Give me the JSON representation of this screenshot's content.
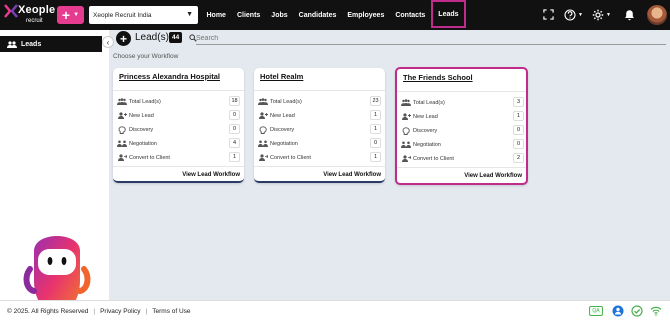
{
  "brand": {
    "name": "Xeople",
    "sub": "recruit"
  },
  "topbar": {
    "add_label": "+",
    "company": "Xeople Recruit India",
    "nav": [
      "Home",
      "Clients",
      "Jobs",
      "Candidates",
      "Employees",
      "Contacts",
      "Leads"
    ],
    "active_nav": "Leads",
    "icons": [
      "fullscreen-icon",
      "help-icon",
      "settings-icon",
      "bell-icon",
      "avatar"
    ]
  },
  "sidebar": {
    "items": [
      {
        "label": "Leads",
        "icon": "people-icon"
      }
    ]
  },
  "main": {
    "title": "Lead(s)",
    "count": "44",
    "search_placeholder": "Search",
    "workflow_label": "Choose your Workflow",
    "cards": [
      {
        "title": "Princess Alexandra Hospital",
        "rows": [
          {
            "label": "Total Lead(s)",
            "value": "18",
            "icon": "group-icon"
          },
          {
            "label": "New Lead",
            "value": "0",
            "icon": "add-person-icon"
          },
          {
            "label": "Discovery",
            "value": "0",
            "icon": "brain-icon"
          },
          {
            "label": "Negotiation",
            "value": "4",
            "icon": "meeting-icon"
          },
          {
            "label": "Convert to Client",
            "value": "1",
            "icon": "convert-person-icon"
          }
        ],
        "link": "View Lead Workflow",
        "highlighted": false
      },
      {
        "title": "Hotel Realm",
        "rows": [
          {
            "label": "Total Lead(s)",
            "value": "23",
            "icon": "group-icon"
          },
          {
            "label": "New Lead",
            "value": "1",
            "icon": "add-person-icon"
          },
          {
            "label": "Discovery",
            "value": "1",
            "icon": "brain-icon"
          },
          {
            "label": "Negotiation",
            "value": "0",
            "icon": "meeting-icon"
          },
          {
            "label": "Convert to Client",
            "value": "1",
            "icon": "convert-person-icon"
          }
        ],
        "link": "View Lead Workflow",
        "highlighted": false
      },
      {
        "title": "The Friends School",
        "rows": [
          {
            "label": "Total Lead(s)",
            "value": "3",
            "icon": "group-icon"
          },
          {
            "label": "New Lead",
            "value": "1",
            "icon": "add-person-icon"
          },
          {
            "label": "Discovery",
            "value": "0",
            "icon": "brain-icon"
          },
          {
            "label": "Negotiation",
            "value": "0",
            "icon": "meeting-icon"
          },
          {
            "label": "Convert to Client",
            "value": "2",
            "icon": "convert-person-icon"
          }
        ],
        "link": "View Lead Workflow",
        "highlighted": true
      }
    ]
  },
  "footer": {
    "copyright": "© 2025. All Rights Reserved",
    "privacy": "Privacy Policy",
    "terms": "Terms of Use",
    "qa": "QA"
  },
  "colors": {
    "accent": "#e63c8f",
    "highlight": "#c02c8c",
    "topbar": "#111111",
    "success": "#4caf50",
    "info": "#1e73d8"
  }
}
